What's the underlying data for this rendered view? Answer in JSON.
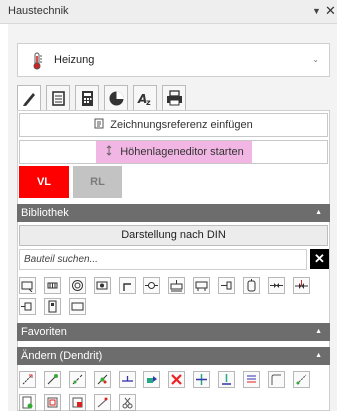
{
  "window": {
    "title": "Haustechnik",
    "menu_glyph": "▼",
    "close_glyph": "✕"
  },
  "discipline_dropdown": {
    "value": "Heizung",
    "icon": "thermometer-icon"
  },
  "tabs": [
    {
      "name": "pencil-icon",
      "active": true
    },
    {
      "name": "list-icon",
      "active": false
    },
    {
      "name": "calculator-icon",
      "active": false
    },
    {
      "name": "pie-chart-icon",
      "active": false
    },
    {
      "name": "text-style-icon",
      "active": false
    },
    {
      "name": "printer-icon",
      "active": false
    }
  ],
  "actions": {
    "insert_reference": "Zeichnungsreferenz einfügen",
    "height_editor": "Höhenlageneditor starten"
  },
  "flow": {
    "vl": "VL",
    "rl": "RL",
    "vl_color": "#ff0000",
    "rl_color": "#c3c3c3"
  },
  "library": {
    "header": "Bibliothek",
    "din_button": "Darstellung nach DIN",
    "search_placeholder": "Bauteil suchen...",
    "clear_glyph": "✕",
    "icons": [
      "box-arrow-icon",
      "radiator-icon",
      "circle-target-icon",
      "pump-icon",
      "elbow-icon",
      "valve-icon",
      "distributor-icon",
      "heater-icon",
      "connector-icon",
      "tank-icon",
      "mixer-icon",
      "three-way-valve-icon",
      "plug-icon",
      "boiler-icon",
      "panel-icon"
    ]
  },
  "favorites": {
    "header": "Favoriten"
  },
  "modify": {
    "header": "Ändern (Dendrit)",
    "icons": [
      "move-icon",
      "connect-icon",
      "split-icon",
      "join-icon",
      "tee-icon",
      "flow-icon",
      "delete-icon",
      "cross-icon",
      "insert-icon",
      "align-icon",
      "bend-icon",
      "extend-icon",
      "document-icon",
      "frame-icon",
      "frame-delete-icon",
      "slope-icon",
      "scissors-icon"
    ]
  }
}
